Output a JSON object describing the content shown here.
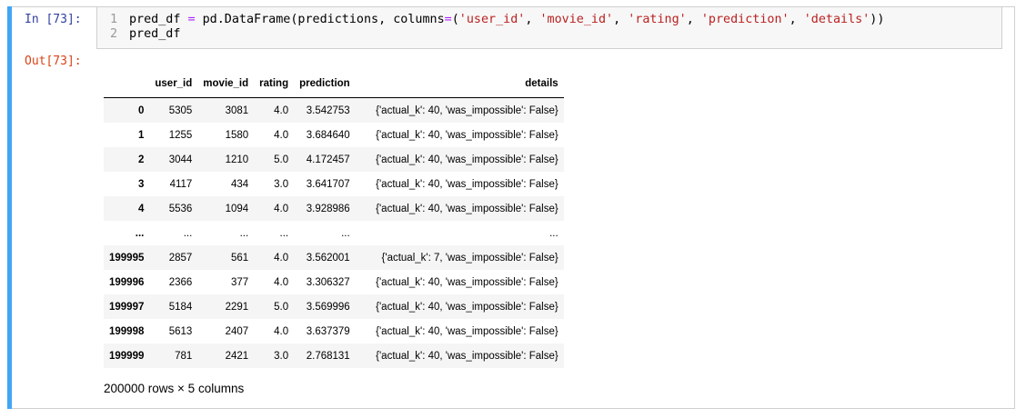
{
  "cell": {
    "in_prompt": "In [73]:",
    "out_prompt": "Out[73]:",
    "code_lines": [
      {
        "num": "1",
        "parts": [
          {
            "t": "pred_df ",
            "c": ""
          },
          {
            "t": "=",
            "c": "op"
          },
          {
            "t": " pd.DataFrame(predictions, columns",
            "c": ""
          },
          {
            "t": "=",
            "c": "op"
          },
          {
            "t": "(",
            "c": ""
          },
          {
            "t": "'user_id'",
            "c": "str"
          },
          {
            "t": ", ",
            "c": ""
          },
          {
            "t": "'movie_id'",
            "c": "str"
          },
          {
            "t": ", ",
            "c": ""
          },
          {
            "t": "'rating'",
            "c": "str"
          },
          {
            "t": ", ",
            "c": ""
          },
          {
            "t": "'prediction'",
            "c": "str"
          },
          {
            "t": ", ",
            "c": ""
          },
          {
            "t": "'details'",
            "c": "str"
          },
          {
            "t": "))",
            "c": ""
          }
        ]
      },
      {
        "num": "2",
        "parts": [
          {
            "t": "pred_df",
            "c": ""
          }
        ]
      }
    ]
  },
  "table": {
    "columns": [
      "",
      "user_id",
      "movie_id",
      "rating",
      "prediction",
      "details"
    ],
    "rows": [
      [
        "0",
        "5305",
        "3081",
        "4.0",
        "3.542753",
        "{'actual_k': 40, 'was_impossible': False}"
      ],
      [
        "1",
        "1255",
        "1580",
        "4.0",
        "3.684640",
        "{'actual_k': 40, 'was_impossible': False}"
      ],
      [
        "2",
        "3044",
        "1210",
        "5.0",
        "4.172457",
        "{'actual_k': 40, 'was_impossible': False}"
      ],
      [
        "3",
        "4117",
        "434",
        "3.0",
        "3.641707",
        "{'actual_k': 40, 'was_impossible': False}"
      ],
      [
        "4",
        "5536",
        "1094",
        "4.0",
        "3.928986",
        "{'actual_k': 40, 'was_impossible': False}"
      ],
      [
        "...",
        "...",
        "...",
        "...",
        "...",
        "..."
      ],
      [
        "199995",
        "2857",
        "561",
        "4.0",
        "3.562001",
        "{'actual_k': 7, 'was_impossible': False}"
      ],
      [
        "199996",
        "2366",
        "377",
        "4.0",
        "3.306327",
        "{'actual_k': 40, 'was_impossible': False}"
      ],
      [
        "199997",
        "5184",
        "2291",
        "5.0",
        "3.569996",
        "{'actual_k': 40, 'was_impossible': False}"
      ],
      [
        "199998",
        "5613",
        "2407",
        "4.0",
        "3.637379",
        "{'actual_k': 40, 'was_impossible': False}"
      ],
      [
        "199999",
        "781",
        "2421",
        "3.0",
        "2.768131",
        "{'actual_k': 40, 'was_impossible': False}"
      ]
    ],
    "shape_text": "200000 rows × 5 columns"
  },
  "colors": {
    "cell_accent": "#42a5f5",
    "in_prompt": "#303f9f",
    "out_prompt": "#d84315",
    "string": "#ba2121",
    "operator": "#aa22ff"
  }
}
